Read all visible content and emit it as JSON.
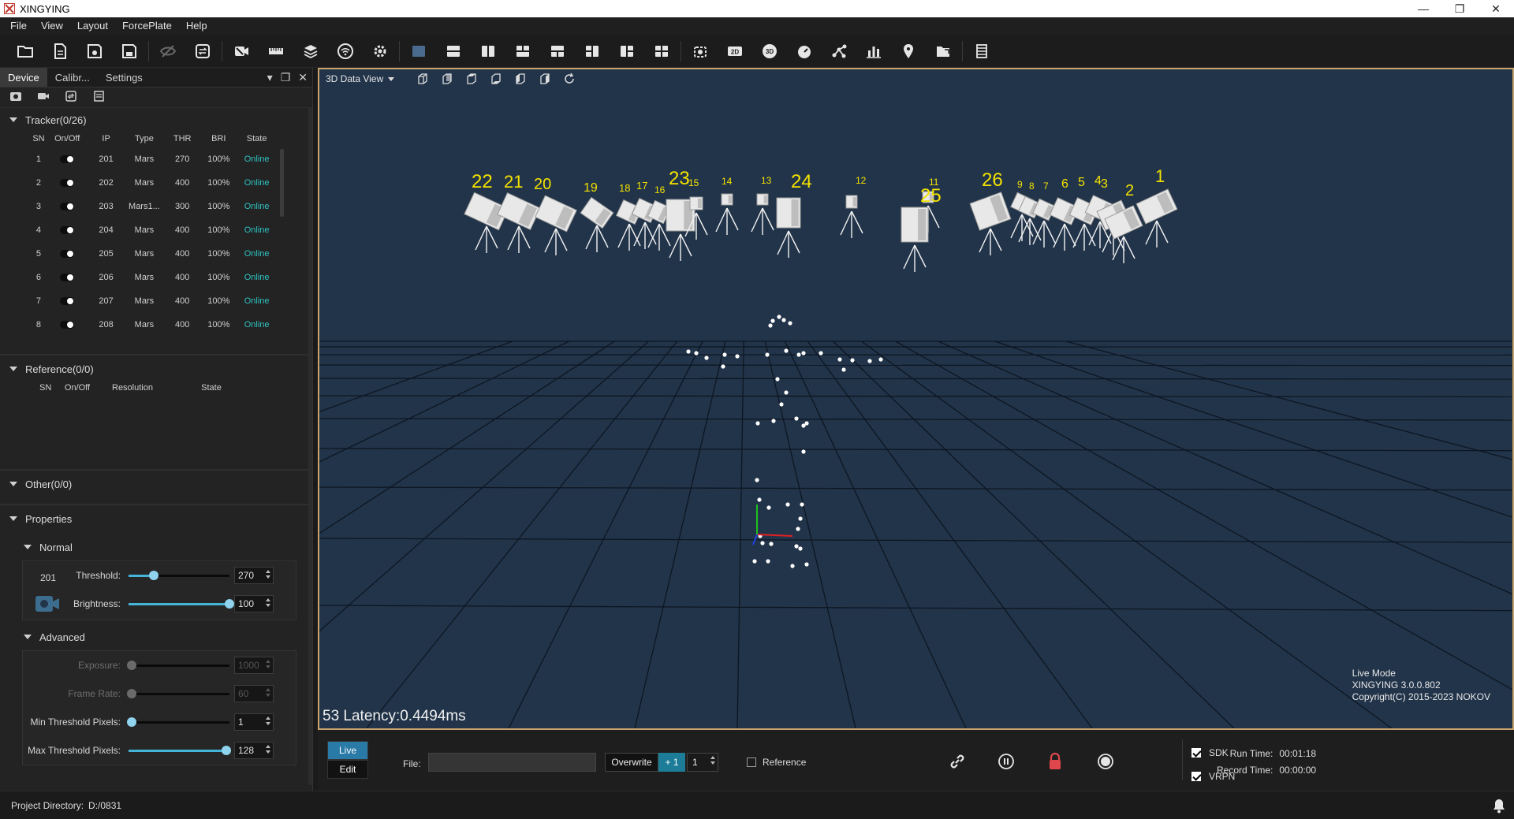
{
  "app": {
    "title": "XINGYING"
  },
  "menu": [
    "File",
    "View",
    "Layout",
    "ForcePlate",
    "Help"
  ],
  "left_panel": {
    "tabs": [
      "Device",
      "Calibr...",
      "Settings"
    ],
    "tracker": {
      "header": "Tracker(0/26)",
      "columns": [
        "SN",
        "On/Off",
        "IP",
        "Type",
        "THR",
        "BRI",
        "State"
      ],
      "rows": [
        {
          "sn": "1",
          "ip": "201",
          "type": "Mars",
          "thr": "270",
          "bri": "100%",
          "state": "Online"
        },
        {
          "sn": "2",
          "ip": "202",
          "type": "Mars",
          "thr": "400",
          "bri": "100%",
          "state": "Online"
        },
        {
          "sn": "3",
          "ip": "203",
          "type": "Mars1...",
          "thr": "300",
          "bri": "100%",
          "state": "Online"
        },
        {
          "sn": "4",
          "ip": "204",
          "type": "Mars",
          "thr": "400",
          "bri": "100%",
          "state": "Online"
        },
        {
          "sn": "5",
          "ip": "205",
          "type": "Mars",
          "thr": "400",
          "bri": "100%",
          "state": "Online"
        },
        {
          "sn": "6",
          "ip": "206",
          "type": "Mars",
          "thr": "400",
          "bri": "100%",
          "state": "Online"
        },
        {
          "sn": "7",
          "ip": "207",
          "type": "Mars",
          "thr": "400",
          "bri": "100%",
          "state": "Online"
        },
        {
          "sn": "8",
          "ip": "208",
          "type": "Mars",
          "thr": "400",
          "bri": "100%",
          "state": "Online"
        }
      ]
    },
    "reference": {
      "header": "Reference(0/0)",
      "columns": [
        "SN",
        "On/Off",
        "Resolution",
        "State"
      ]
    },
    "other": {
      "header": "Other(0/0)"
    },
    "properties": {
      "header": "Properties",
      "normal": {
        "header": "Normal",
        "device_id": "201",
        "threshold_label": "Threshold:",
        "threshold_value": "270",
        "threshold_level": 0.25,
        "brightness_label": "Brightness:",
        "brightness_value": "100",
        "brightness_level": 1.0
      },
      "advanced": {
        "header": "Advanced",
        "exposure_label": "Exposure:",
        "exposure_value": "1000",
        "frame_rate_label": "Frame Rate:",
        "frame_rate_value": "60",
        "min_thr_label": "Min Threshold Pixels:",
        "min_thr_value": "1",
        "max_thr_label": "Max Threshold Pixels:",
        "max_thr_value": "128"
      }
    }
  },
  "viewport": {
    "view_name": "3D Data View",
    "latency": "53 Latency:0.4494ms",
    "mode": "Live Mode",
    "version": "XINGYING 3.0.0.802",
    "copyright": "Copyright(C) 2015-2023 NOKOV",
    "camera_labels": [
      "22",
      "21",
      "20",
      "19",
      "18",
      "17",
      "16",
      "23",
      "15",
      "14",
      "13",
      "24",
      "12",
      "11",
      "25",
      "26",
      "9",
      "8",
      "7",
      "6",
      "5",
      "4",
      "3",
      "2",
      "1"
    ]
  },
  "bottom": {
    "live_label": "Live",
    "edit_label": "Edit",
    "file_label": "File:",
    "file_value": "",
    "overwrite_label": "Overwrite",
    "increment_label": "+ 1",
    "take_number": "1",
    "reference_label": "Reference",
    "run_time_label": "Run Time:",
    "run_time_value": "00:01:18",
    "record_time_label": "Record Time:",
    "record_time_value": "00:00:00",
    "sdk_label": "SDK",
    "vrpn_label": "VRPN"
  },
  "status": {
    "project_dir_label": "Project Directory:",
    "project_dir_value": "D:/0831"
  },
  "colors": {
    "accent": "#2a7aa7",
    "online": "#2fc2c2",
    "label_yellow": "#f3e200",
    "viewport_bg": "#22344a",
    "frame": "#c9a46d"
  }
}
